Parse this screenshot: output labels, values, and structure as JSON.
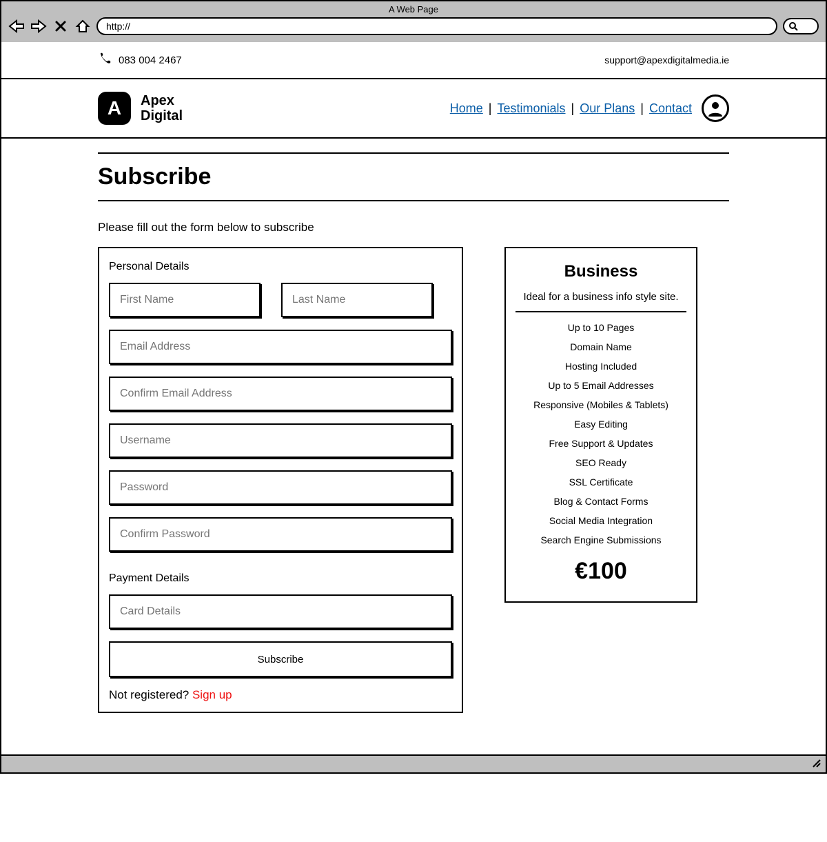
{
  "browser": {
    "title": "A Web Page",
    "url": "http://"
  },
  "topbar": {
    "phone": "083 004 2467",
    "support_email": "support@apexdigitalmedia.ie"
  },
  "brand": {
    "mark": "A",
    "line1": "Apex",
    "line2": "Digital"
  },
  "nav": {
    "home": "Home",
    "testimonials": "Testimonials",
    "plans": "Our Plans",
    "contact": "Contact"
  },
  "page": {
    "title": "Subscribe",
    "instruction": "Please fill out the form below to subscribe"
  },
  "form": {
    "personal_label": "Personal Details",
    "first_name_ph": "First Name",
    "last_name_ph": "Last Name",
    "email_ph": "Email Address",
    "confirm_email_ph": "Confirm Email Address",
    "username_ph": "Username",
    "password_ph": "Password",
    "confirm_password_ph": "Confirm Password",
    "payment_label": "Payment Details",
    "card_ph": "Card Details",
    "submit_label": "Subscribe",
    "not_registered_text": "Not registered? ",
    "sign_up_link": "Sign up"
  },
  "plan": {
    "title": "Business",
    "subtitle": "Ideal for a business info style site.",
    "features": [
      "Up to 10 Pages",
      "Domain Name",
      "Hosting Included",
      "Up to 5 Email Addresses",
      "Responsive (Mobiles & Tablets)",
      "Easy Editing",
      "Free Support & Updates",
      "SEO Ready",
      "SSL Certificate",
      "Blog & Contact Forms",
      "Social Media Integration",
      "Search Engine Submissions"
    ],
    "price": "€100"
  }
}
